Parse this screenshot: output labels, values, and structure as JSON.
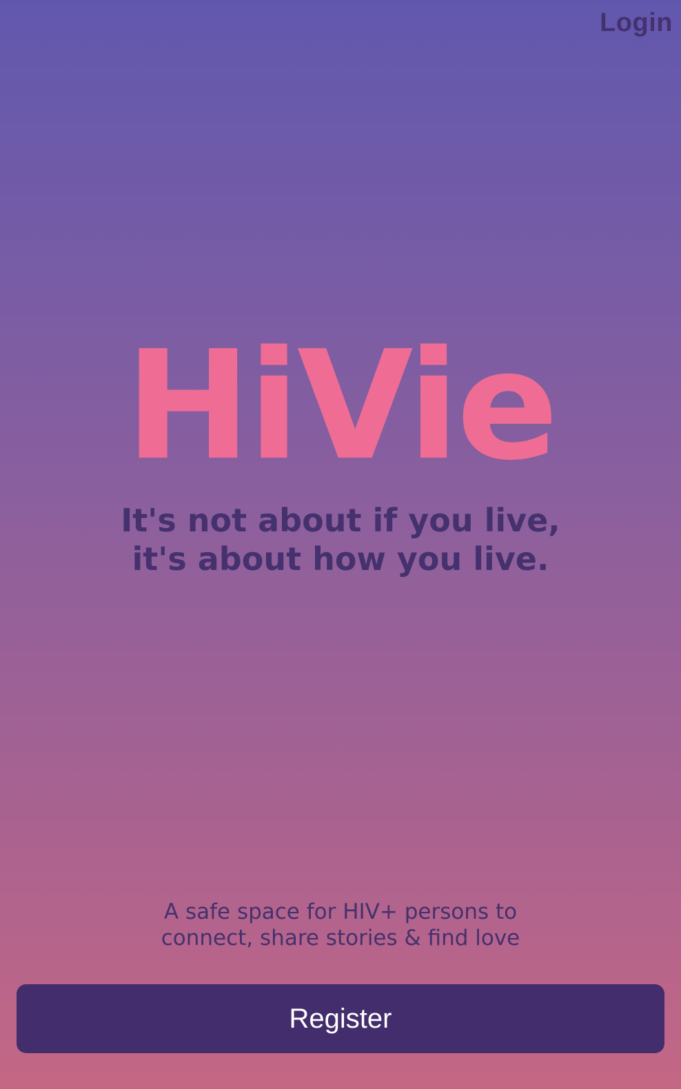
{
  "header": {
    "login_label": "Login"
  },
  "hero": {
    "logo": "HiVie",
    "tagline_line1": "It's not about if you live,",
    "tagline_line2": "it's about how you live."
  },
  "footer": {
    "description_line1": "A safe space for HIV+ persons to",
    "description_line2": "connect, share stories & find love",
    "register_label": "Register"
  },
  "colors": {
    "gradient_top": "#6158ae",
    "gradient_bottom": "#c46785",
    "logo": "#ef6d94",
    "text_dark": "#45316e",
    "button_bg": "#432d6c",
    "button_text": "#ffffff"
  }
}
